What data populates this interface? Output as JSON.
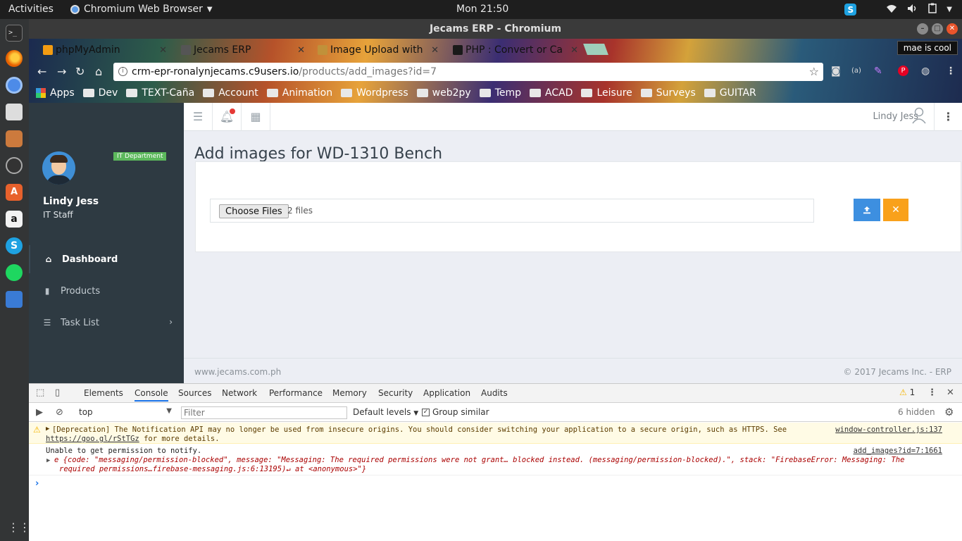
{
  "os": {
    "activities": "Activities",
    "app_menu": "Chromium Web Browser",
    "clock": "Mon 21:50"
  },
  "window": {
    "title": "Jecams ERP - Chromium"
  },
  "browser": {
    "tabs": [
      {
        "label": "phpMyAdmin",
        "favicon_color": "#f39c12"
      },
      {
        "label": "Jecams ERP",
        "favicon_color": "#555555"
      },
      {
        "label": "Image Upload with",
        "favicon_color": "#c0913a"
      },
      {
        "label": "PHP : Convert or Ca",
        "favicon_color": "#1a1a1a"
      }
    ],
    "profile": "mae is cool",
    "url_host": "crm-epr-ronalynjecams.c9users.io",
    "url_path": "/products/add_images?id=7",
    "bookmarks": [
      {
        "label": "Apps",
        "type": "apps"
      },
      {
        "label": "Dev",
        "type": "folder"
      },
      {
        "label": "TEXT-Caña",
        "type": "folder"
      },
      {
        "label": "Account",
        "type": "folder"
      },
      {
        "label": "Animation",
        "type": "folder"
      },
      {
        "label": "Wordpress",
        "type": "folder"
      },
      {
        "label": "web2py",
        "type": "folder"
      },
      {
        "label": "Temp",
        "type": "folder"
      },
      {
        "label": "ACAD",
        "type": "folder"
      },
      {
        "label": "Leisure",
        "type": "folder"
      },
      {
        "label": "Surveys",
        "type": "folder"
      },
      {
        "label": "GUITAR",
        "type": "folder"
      }
    ]
  },
  "app": {
    "sidebar": {
      "dept_badge": "IT Department",
      "user_name": "Lindy Jess",
      "user_role": "IT Staff",
      "nav": [
        {
          "label": "Dashboard",
          "icon": "home-icon",
          "active": true
        },
        {
          "label": "Products",
          "icon": "product-icon",
          "active": false
        },
        {
          "label": "Task List",
          "icon": "list-icon",
          "active": false
        }
      ]
    },
    "header": {
      "user_name": "Lindy Jess"
    },
    "page_title": "Add images for WD-1310 Bench",
    "file_input": {
      "button_label": "Choose Files",
      "status": "2 files"
    },
    "footer": {
      "left": "www.jecams.com.ph",
      "right": "© 2017 Jecams Inc. - ERP"
    }
  },
  "devtools": {
    "tabs": [
      "Elements",
      "Console",
      "Sources",
      "Network",
      "Performance",
      "Memory",
      "Security",
      "Application",
      "Audits"
    ],
    "active_tab": "Console",
    "warning_count": "1",
    "context": "top",
    "filter_placeholder": "Filter",
    "levels": "Default levels",
    "group_similar": "Group similar",
    "hidden": "6 hidden",
    "messages": {
      "warn_line1": "[Deprecation] The Notification API may no longer be used from insecure origins. You should consider switching your application to a secure origin, such as HTTPS. See",
      "warn_link": "https://goo.gl/rStTGz",
      "warn_line2_rest": " for more details.",
      "warn_source": "window-controller.js:137",
      "log_line1": "Unable to get permission to notify.",
      "log_source": "add_images?id=7:1661",
      "log_obj_line1": "e {code: \"messaging/permission-blocked\", message: \"Messaging: The required permissions were not grant… blocked instead. (messaging/permission-blocked).\", stack: \"FirebaseError: Messaging: The",
      "log_obj_line2": "required permissions…firebase-messaging.js:6:13195)↵    at <anonymous>\"}"
    }
  }
}
